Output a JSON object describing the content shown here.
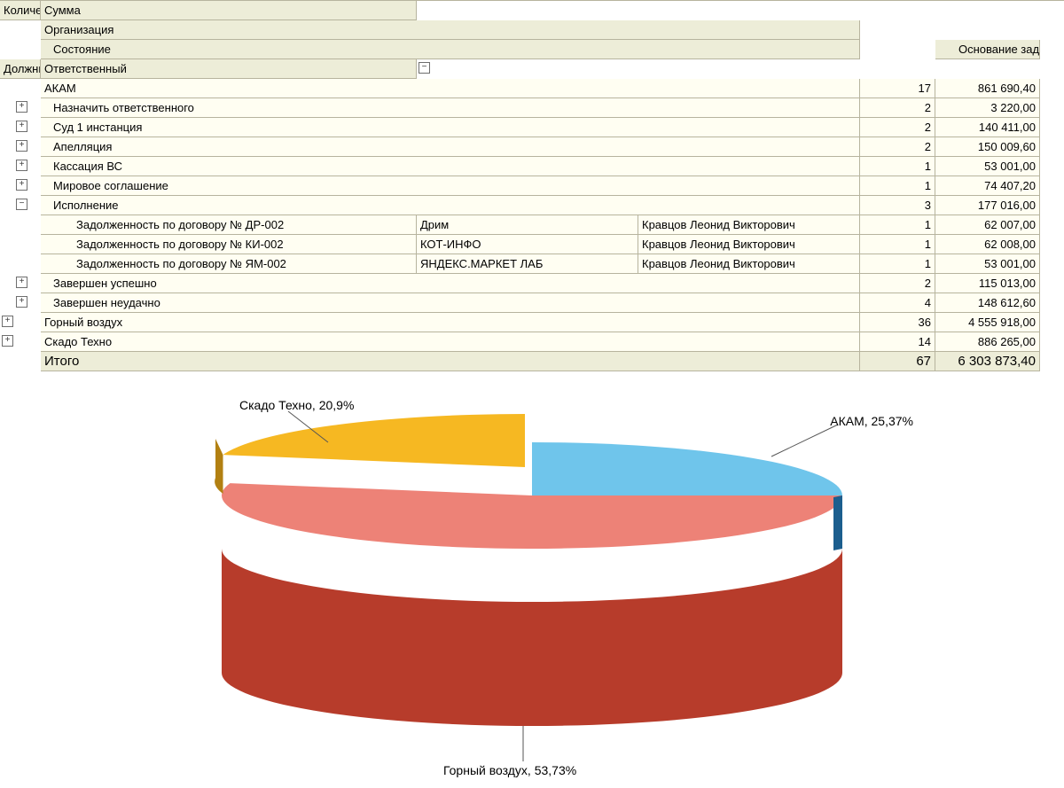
{
  "headers": {
    "org": "Организация",
    "state": "Состояние",
    "basis": "Основание задолженности",
    "debtor": "Должник",
    "responsible": "Ответственный",
    "qty": "Количество",
    "sum": "Сумма"
  },
  "rows": [
    {
      "type": "org",
      "tw": "minus",
      "twlvl": 0,
      "name": "АКАМ",
      "qty": "17",
      "sum": "861 690,40"
    },
    {
      "type": "state",
      "tw": "plus",
      "twlvl": 1,
      "name": "Назначить ответственного",
      "qty": "2",
      "sum": "3 220,00"
    },
    {
      "type": "state",
      "tw": "plus",
      "twlvl": 1,
      "name": "Суд 1 инстанция",
      "qty": "2",
      "sum": "140 411,00"
    },
    {
      "type": "state",
      "tw": "plus",
      "twlvl": 1,
      "name": "Апелляция",
      "qty": "2",
      "sum": "150 009,60"
    },
    {
      "type": "state",
      "tw": "plus",
      "twlvl": 1,
      "name": "Кассация ВС",
      "qty": "1",
      "sum": "53 001,00"
    },
    {
      "type": "state",
      "tw": "plus",
      "twlvl": 1,
      "name": "Мировое соглашение",
      "qty": "1",
      "sum": "74 407,20"
    },
    {
      "type": "state",
      "tw": "minus",
      "twlvl": 1,
      "name": "Исполнение",
      "qty": "3",
      "sum": "177 016,00"
    },
    {
      "type": "detail",
      "name": "Задолженность по договору № ДР-002",
      "debtor": "Дрим",
      "resp": "Кравцов Леонид Викторович",
      "qty": "1",
      "sum": "62 007,00"
    },
    {
      "type": "detail",
      "name": "Задолженность по договору № КИ-002",
      "debtor": "КОТ-ИНФО",
      "resp": "Кравцов Леонид Викторович",
      "qty": "1",
      "sum": "62 008,00"
    },
    {
      "type": "detail",
      "name": "Задолженность по договору № ЯМ-002",
      "debtor": "ЯНДЕКС.МАРКЕТ ЛАБ",
      "resp": "Кравцов Леонид Викторович",
      "qty": "1",
      "sum": "53 001,00"
    },
    {
      "type": "state",
      "tw": "plus",
      "twlvl": 1,
      "name": "Завершен успешно",
      "qty": "2",
      "sum": "115 013,00"
    },
    {
      "type": "state",
      "tw": "plus",
      "twlvl": 1,
      "name": "Завершен неудачно",
      "qty": "4",
      "sum": "148 612,60"
    },
    {
      "type": "org",
      "tw": "plus",
      "twlvl": 0,
      "name": "Горный воздух",
      "qty": "36",
      "sum": "4 555 918,00"
    },
    {
      "type": "org",
      "tw": "plus",
      "twlvl": 0,
      "name": "Скадо Техно",
      "qty": "14",
      "sum": "886 265,00"
    }
  ],
  "total": {
    "label": "Итого",
    "qty": "67",
    "sum": "6 303 873,40"
  },
  "chart_data": {
    "type": "pie-3d",
    "labels": {
      "akam": "АКАМ, 25,37%",
      "gornyi": "Горный воздух, 53,73%",
      "skado": "Скадо Техно, 20,9%"
    },
    "series": [
      {
        "name": "АКАМ",
        "value": 25.37,
        "color": "#6fc5eb",
        "side": "#1c5e8e"
      },
      {
        "name": "Горный воздух",
        "value": 53.73,
        "color": "#ed8277",
        "side": "#b73c2b"
      },
      {
        "name": "Скадо Техно",
        "value": 20.9,
        "color": "#f6b822",
        "side": "#b28012"
      }
    ]
  }
}
